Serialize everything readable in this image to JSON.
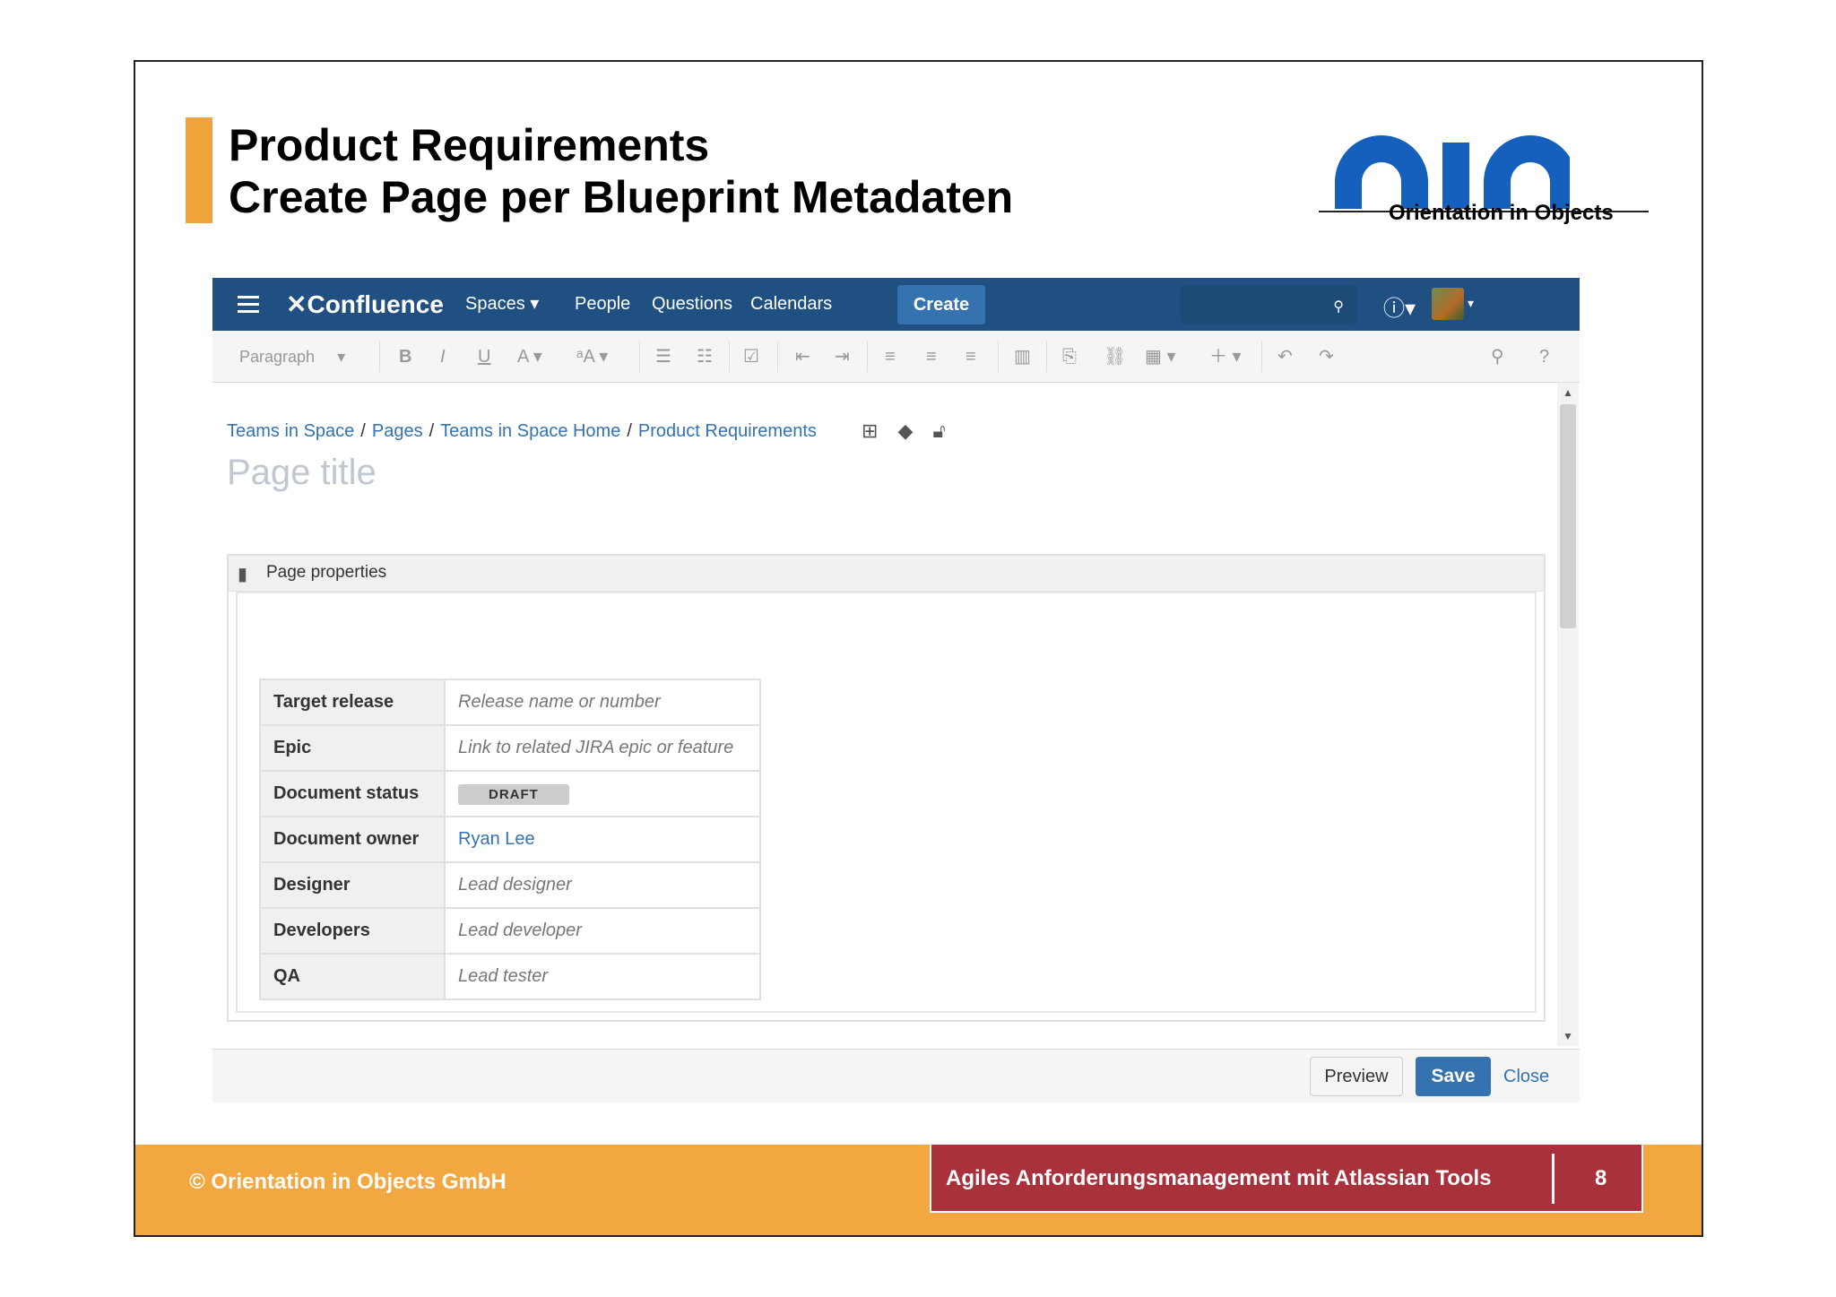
{
  "slide": {
    "title_line1": "Product Requirements",
    "title_line2": "Create Page per Blueprint Metadaten",
    "logo_text": "oio",
    "logo_caption": "Orientation in Objects",
    "copyright": "© Orientation in Objects GmbH",
    "course_title": "Agiles Anforderungsmanagement mit Atlassian Tools",
    "page_number": "8",
    "colors": {
      "accent_orange": "#f2a741",
      "course_red": "#a8313c",
      "logo_blue": "#1560bd"
    }
  },
  "header": {
    "brand": "Confluence",
    "nav": [
      "Spaces",
      "People",
      "Questions",
      "Calendars"
    ],
    "create_label": "Create",
    "icons": [
      "menu-icon",
      "search-icon",
      "help-icon",
      "notifications-icon",
      "avatar"
    ]
  },
  "toolbar": {
    "paragraph_select": "Paragraph",
    "buttons": [
      "bold",
      "italic",
      "underline",
      "text-color",
      "formatting",
      "bullet-list",
      "numbered-list",
      "task-list",
      "outdent",
      "indent",
      "align-left",
      "align-center",
      "align-right",
      "page-layout",
      "insert-file",
      "link",
      "table",
      "insert-more",
      "undo",
      "redo",
      "find",
      "help"
    ]
  },
  "breadcrumb": [
    "Teams in Space",
    "Pages",
    "Teams in Space Home",
    "Product Requirements"
  ],
  "page_title_placeholder": "Page title",
  "macro": {
    "label": "Page properties",
    "rows": [
      {
        "key": "Target release",
        "value": "Release name or number"
      },
      {
        "key": "Epic",
        "value": "Link to related JIRA epic or feature"
      },
      {
        "key": "Document status",
        "value": "DRAFT"
      },
      {
        "key": "Document owner",
        "value": "Ryan Lee"
      },
      {
        "key": "Designer",
        "value": "Lead designer"
      },
      {
        "key": "Developers",
        "value": "Lead developer"
      },
      {
        "key": "QA",
        "value": "Lead tester"
      }
    ]
  },
  "footer": {
    "preview": "Preview",
    "save": "Save",
    "close": "Close"
  }
}
